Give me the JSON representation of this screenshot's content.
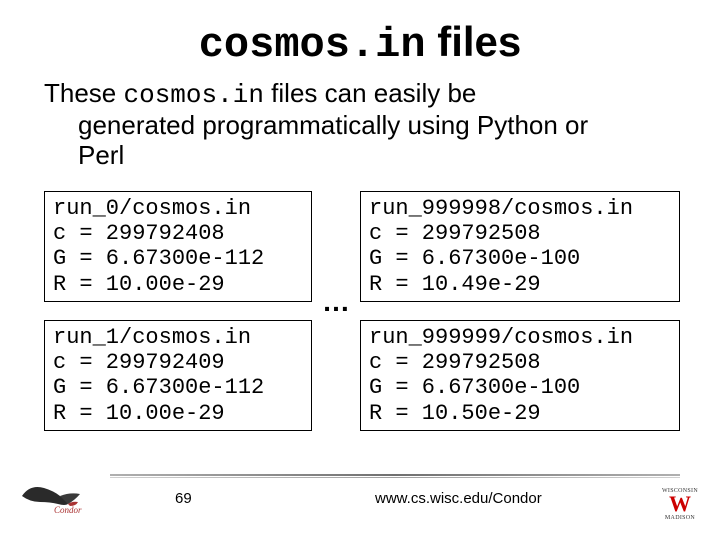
{
  "title": {
    "pre": "cosmos.in",
    "post": " files"
  },
  "body": {
    "line1_pre": "These ",
    "line1_code": "cosmos.in",
    "line1_post": " files can easily be",
    "line2": "generated programmatically using Python or",
    "line3": "Perl"
  },
  "boxes": {
    "tl": "run_0/cosmos.in\nc = 299792408\nG = 6.67300e-112\nR = 10.00e-29",
    "bl": "run_1/cosmos.in\nc = 299792409\nG = 6.67300e-112\nR = 10.00e-29",
    "tr": "run_999998/cosmos.in\nc = 299792508\nG = 6.67300e-100\nR = 10.49e-29",
    "br": "run_999999/cosmos.in\nc = 299792508\nG = 6.67300e-100\nR = 10.50e-29"
  },
  "ellipsis": "…",
  "footer": {
    "page": "69",
    "url": "www.cs.wisc.edu/Condor",
    "logo_left_alt": "Condor",
    "logo_right_top": "WISCONSIN",
    "logo_right_mid": "W",
    "logo_right_bottom": "MADISON"
  }
}
